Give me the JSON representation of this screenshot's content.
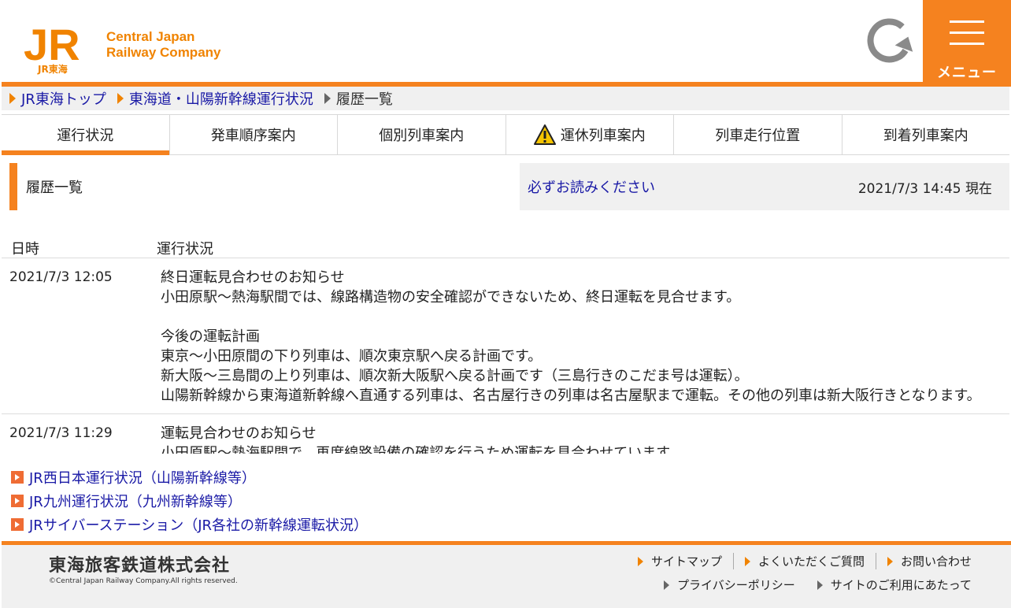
{
  "header": {
    "logo_jr": "JR",
    "logo_sub": "JR東海",
    "logo_line1": "Central Japan",
    "logo_line2": "Railway Company",
    "menu_label": "メニュー"
  },
  "breadcrumb": [
    {
      "label": "JR東海トップ"
    },
    {
      "label": "東海道・山陽新幹線運行状況"
    },
    {
      "label": "履歴一覧"
    }
  ],
  "tabs": [
    {
      "label": "運行状況"
    },
    {
      "label": "発車順序案内"
    },
    {
      "label": "個別列車案内"
    },
    {
      "label": "運休列車案内"
    },
    {
      "label": "列車走行位置"
    },
    {
      "label": "到着列車案内"
    }
  ],
  "section": {
    "title": "履歴一覧",
    "notice_link": "必ずお読みください",
    "timestamp": "2021/7/3 14:45 現在"
  },
  "table": {
    "col_date": "日時",
    "col_status": "運行状況",
    "rows": [
      {
        "date": "2021/7/3 12:05",
        "lines": [
          "終日運転見合わせのお知らせ",
          "小田原駅～熱海駅間では、線路構造物の安全確認ができないため、終日運転を見合せます。",
          "",
          "今後の運転計画",
          "東京～小田原間の下り列車は、順次東京駅へ戻る計画です。",
          "新大阪～三島間の上り列車は、順次新大阪駅へ戻る計画です（三島行きのこだま号は運転）。",
          "山陽新幹線から東海道新幹線へ直通する列車は、名古屋行きの列車は名古屋駅まで運転。その他の列車は新大阪行きとなります。"
        ]
      },
      {
        "date": "2021/7/3 11:29",
        "lines": [
          "運転見合わせのお知らせ",
          "小田原駅～熱海駅間で、再度線路設備の確認を行うため運転を見合わせています。"
        ]
      }
    ]
  },
  "external_links": [
    {
      "label": "JR西日本運行状況（山陽新幹線等）"
    },
    {
      "label": "JR九州運行状況（九州新幹線等）"
    },
    {
      "label": "JRサイバーステーション（JR各社の新幹線運転状況）"
    }
  ],
  "footer": {
    "company": "東海旅客鉄道株式会社",
    "copyright": "©Central Japan Railway Company.All rights reserved.",
    "links_row1": [
      "サイトマップ",
      "よくいただくご質問",
      "お問い合わせ"
    ],
    "links_row2": [
      "プライバシーポリシー",
      "サイトのご利用にあたって"
    ]
  },
  "colors": {
    "accent": "#f5821f",
    "link": "#1a1aa6",
    "panel": "#f0f0f0"
  }
}
